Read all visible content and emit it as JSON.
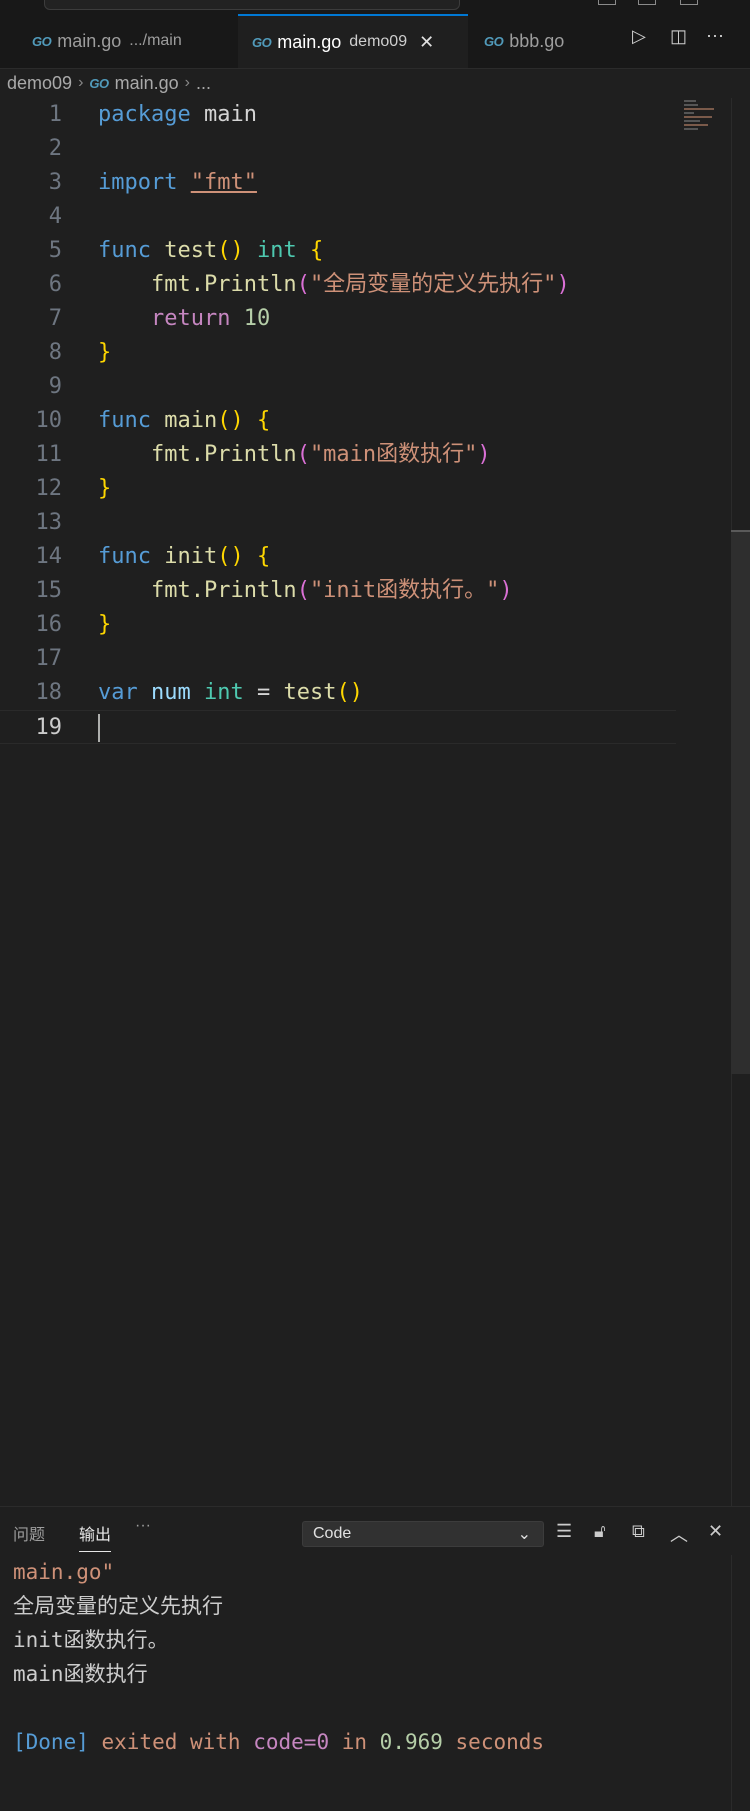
{
  "tabs": [
    {
      "icon": "go-icon",
      "icon_text": "GO",
      "name": "main.go",
      "description": ".../main",
      "active": false
    },
    {
      "icon": "go-icon",
      "icon_text": "GO",
      "name": "main.go",
      "description": "demo09",
      "active": true,
      "close": "✕"
    },
    {
      "icon": "go-icon",
      "icon_text": "GO",
      "name": "bbb.go",
      "active": false
    }
  ],
  "actions": {
    "run": "▷",
    "split": "◫",
    "more": "⋯"
  },
  "breadcrumb": {
    "folder": "demo09",
    "file": "main.go",
    "more": "..."
  },
  "editor": {
    "current_line": 19,
    "line_numbers": [
      "1",
      "2",
      "3",
      "4",
      "5",
      "6",
      "7",
      "8",
      "9",
      "10",
      "11",
      "12",
      "13",
      "14",
      "15",
      "16",
      "17",
      "18",
      "19"
    ],
    "tokens": {
      "package": "package",
      "main_ident": "main",
      "import": "import",
      "fmt_import": "\"fmt\"",
      "func": "func",
      "test_call": "test",
      "parens": "()",
      "int": "int",
      "lbrace": "{",
      "rbrace": "}",
      "fmt_println": "fmt.Println",
      "lparen": "(",
      "rparen": ")",
      "str1": "\"全局变量的定义先执行\"",
      "return": "return",
      "ten": "10",
      "main_fn": "main",
      "str2": "\"main函数执行\"",
      "init_fn": "init",
      "str3": "\"init函数执行。\"",
      "var": "var",
      "num": "num",
      "eq": "="
    }
  },
  "panel": {
    "tab_problems": "问题",
    "tab_output": "输出",
    "more": "···",
    "channel": "Code",
    "output_lines": [
      "main.go\"",
      "全局变量的定义先执行",
      "init函数执行。",
      "main函数执行",
      ""
    ],
    "done": {
      "tag": "[Done]",
      "exited": " exited with ",
      "code": "code=0",
      "in": " in ",
      "time": "0.969",
      "seconds": " seconds"
    }
  }
}
